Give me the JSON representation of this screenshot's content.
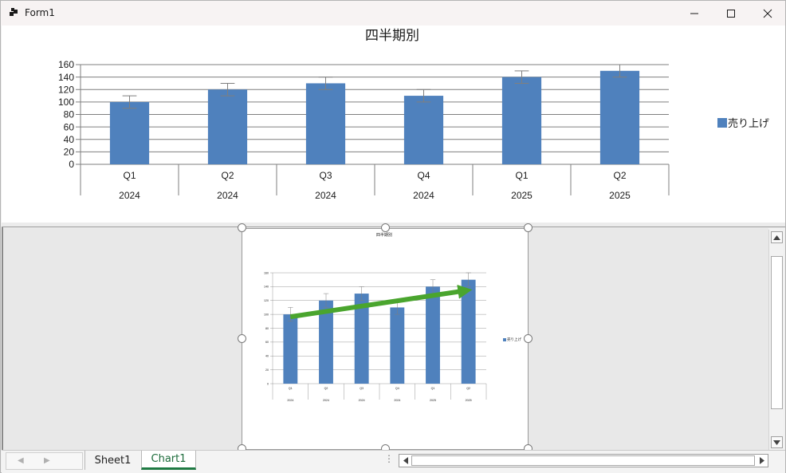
{
  "window": {
    "title": "Form1",
    "buttons": [
      "minimize-icon",
      "maximize-icon",
      "close-icon"
    ]
  },
  "colors": {
    "bar": "#4f81bd",
    "grid": "#7f7f7f",
    "error_bar": "#7f7f7f",
    "trend_arrow": "#4aa52e",
    "active_tab_text": "#1c6b3a"
  },
  "chart_data": {
    "type": "bar",
    "title": "四半期別",
    "categories": [
      "Q1",
      "Q2",
      "Q3",
      "Q4",
      "Q1",
      "Q2"
    ],
    "groups": [
      "2024",
      "2024",
      "2024",
      "2024",
      "2025",
      "2025"
    ],
    "series": [
      {
        "name": "売り上げ",
        "values": [
          100,
          120,
          130,
          110,
          140,
          150
        ],
        "error": [
          10,
          10,
          10,
          10,
          10,
          10
        ]
      }
    ],
    "y_ticks": [
      "0",
      "20",
      "40",
      "60",
      "80",
      "100",
      "120",
      "140",
      "160"
    ],
    "ylim": [
      0,
      160
    ],
    "grid": true,
    "legend_position": "right",
    "error_bars": true
  },
  "embedded_chart": {
    "annotation": "trend-arrow"
  },
  "sheet_tabs": [
    {
      "label": "Sheet1",
      "active": false
    },
    {
      "label": "Chart1",
      "active": true
    }
  ],
  "tab_nav": {
    "prev": "◀",
    "next": "▶",
    "grip": "⋮"
  }
}
